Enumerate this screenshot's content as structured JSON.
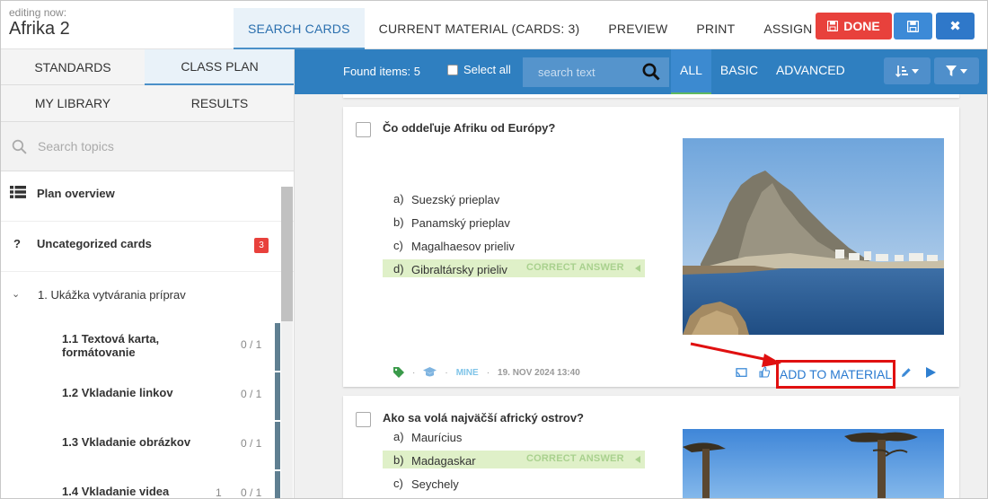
{
  "header": {
    "editing_label": "editing now:",
    "title": "Afrika 2",
    "tabs": [
      {
        "label": "SEARCH CARDS",
        "active": true
      },
      {
        "label": "CURRENT MATERIAL (CARDS: 3)",
        "active": false
      },
      {
        "label": "PREVIEW",
        "active": false
      },
      {
        "label": "PRINT",
        "active": false
      },
      {
        "label": "ASSIGN",
        "active": false
      }
    ],
    "done_label": "DONE",
    "colors": {
      "done": "#e8413c",
      "save": "#3c8ad7",
      "close": "#2f78c9"
    }
  },
  "sidebar": {
    "tabs": [
      {
        "label": "STANDARDS",
        "active": false
      },
      {
        "label": "CLASS PLAN",
        "active": true
      },
      {
        "label": "MY LIBRARY",
        "active": false
      },
      {
        "label": "RESULTS",
        "active": false
      }
    ],
    "search_placeholder": "Search topics",
    "plan_overview": "Plan overview",
    "uncategorized": {
      "icon": "?",
      "label": "Uncategorized cards",
      "badge": "3"
    },
    "unit": "1. Ukážka vytvárania príprav",
    "lessons": [
      {
        "number": "1.1",
        "title": "Textová karta, formátovanie",
        "count": "0 / 1",
        "extra": ""
      },
      {
        "number": "1.2",
        "title": "Vkladanie linkov",
        "count": "0 / 1",
        "extra": ""
      },
      {
        "number": "1.3",
        "title": "Vkladanie obrázkov",
        "count": "0 / 1",
        "extra": ""
      },
      {
        "number": "1.4",
        "title": "Vkladanie videa",
        "count": "0 / 1",
        "extra": "1"
      }
    ]
  },
  "toolbar": {
    "found": "Found items: 5",
    "select_all": "Select all",
    "search_placeholder": "search text",
    "filters": [
      {
        "label": "ALL",
        "active": true
      },
      {
        "label": "BASIC",
        "active": false
      },
      {
        "label": "ADVANCED",
        "active": false
      }
    ],
    "color": "#2f7fc0"
  },
  "cards": [
    {
      "question": "Čo oddeľuje Afriku od Európy?",
      "answers": [
        {
          "letter": "a)",
          "text": "Suezský prieplav",
          "correct": false
        },
        {
          "letter": "b)",
          "text": "Panamský prieplav",
          "correct": false
        },
        {
          "letter": "c)",
          "text": "Magalhaesov prieliv",
          "correct": false
        },
        {
          "letter": "d)",
          "text": "Gibraltársky prieliv",
          "correct": true
        }
      ],
      "correct_label": "CORRECT ANSWER",
      "meta": {
        "owner": "MINE",
        "date": "19. NOV 2024 13:40"
      },
      "add_label": "ADD TO MATERIAL"
    },
    {
      "question": "Ako sa volá najväčší africký ostrov?",
      "answers": [
        {
          "letter": "a)",
          "text": "Maurícius",
          "correct": false
        },
        {
          "letter": "b)",
          "text": "Madagaskar",
          "correct": true
        },
        {
          "letter": "c)",
          "text": "Seychely",
          "correct": false
        }
      ],
      "correct_label": "CORRECT ANSWER"
    }
  ]
}
